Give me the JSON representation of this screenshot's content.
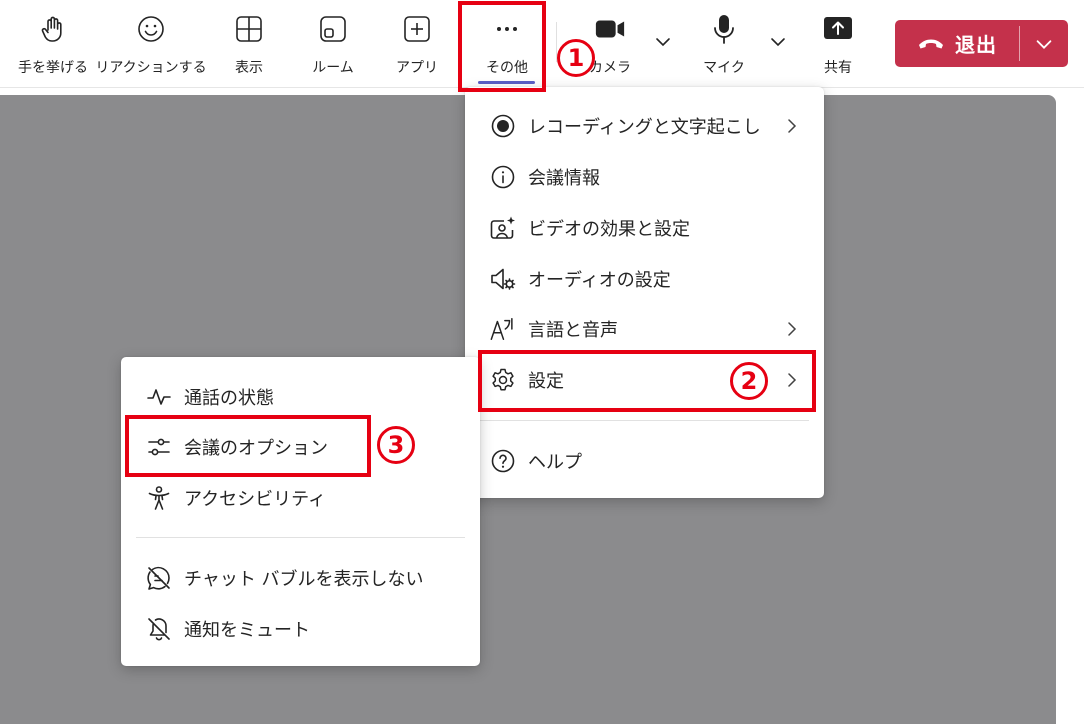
{
  "toolbar": {
    "raise_hand": "手を挙げる",
    "reactions": "リアクションする",
    "view": "表示",
    "rooms": "ルーム",
    "apps": "アプリ",
    "more": "その他",
    "camera": "カメラ",
    "mic": "マイク",
    "share": "共有",
    "leave": "退出"
  },
  "more_menu": {
    "items": [
      {
        "label": "レコーディングと文字起こし",
        "icon": "record-icon",
        "has_submenu": true
      },
      {
        "label": "会議情報",
        "icon": "info-icon",
        "has_submenu": false
      },
      {
        "label": "ビデオの効果と設定",
        "icon": "video-effects-icon",
        "has_submenu": false
      },
      {
        "label": "オーディオの設定",
        "icon": "audio-settings-icon",
        "has_submenu": false
      },
      {
        "label": "言語と音声",
        "icon": "language-icon",
        "has_submenu": true
      },
      {
        "label": "設定",
        "icon": "gear-icon",
        "has_submenu": true
      },
      {
        "label": "ヘルプ",
        "icon": "help-icon",
        "has_submenu": false
      }
    ]
  },
  "settings_submenu": {
    "items": [
      {
        "label": "通話の状態",
        "icon": "call-health-icon"
      },
      {
        "label": "会議のオプション",
        "icon": "options-sliders-icon"
      },
      {
        "label": "アクセシビリティ",
        "icon": "accessibility-icon"
      },
      {
        "label": "チャット バブルを表示しない",
        "icon": "chat-off-icon"
      },
      {
        "label": "通知をミュート",
        "icon": "bell-off-icon"
      }
    ]
  },
  "annotations": {
    "step1": "1",
    "step2": "2",
    "step3": "3",
    "color": "#e60012"
  },
  "colors": {
    "leave_bg": "#c4314b",
    "stage_bg": "#8b8b8d",
    "accent": "#5b5fc7"
  }
}
